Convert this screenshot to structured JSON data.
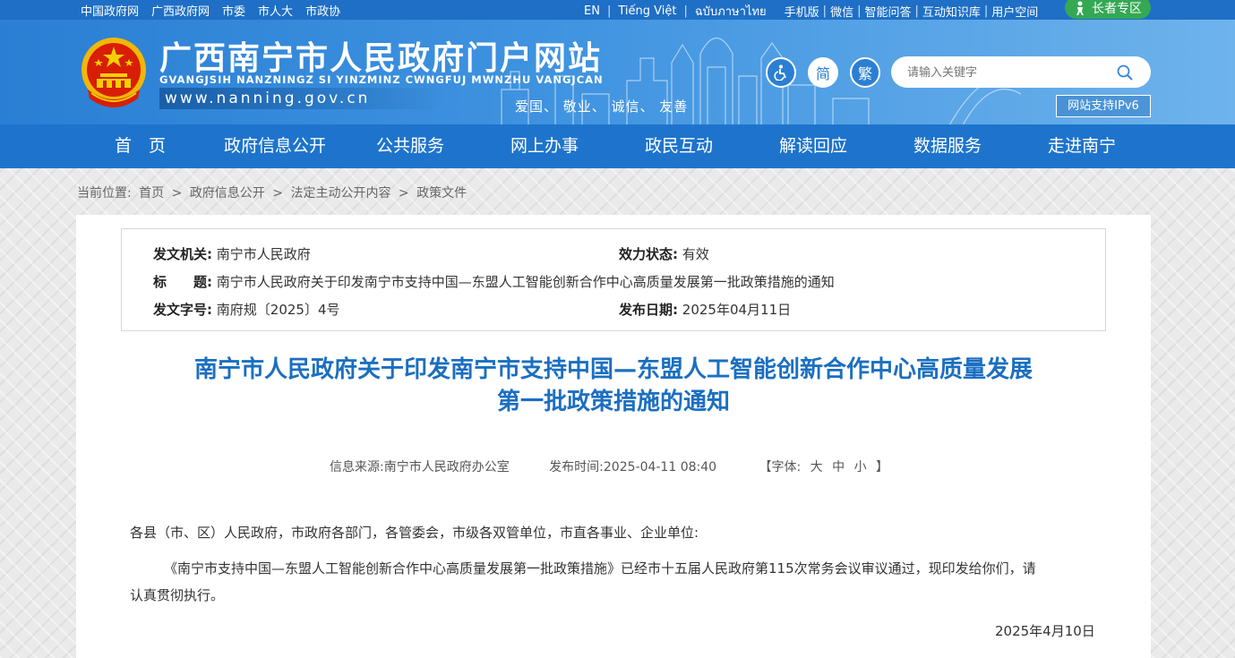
{
  "topbar": {
    "links": [
      "中国政府网",
      "广西政府网",
      "市委",
      "市人大",
      "市政协"
    ],
    "languages": [
      "EN",
      "Tiếng Việt",
      "ฉบับภาษาไทย"
    ],
    "tools": [
      "手机版",
      "微信",
      "智能问答",
      "互动知识库",
      "用户空间"
    ],
    "elder_label": "长者专区"
  },
  "header": {
    "site_title": "广西南宁市人民政府门户网站",
    "site_subtitle": "GVANGJSIH NANZNINGZ SI YINZMINZ CWNGFUJ MWNZHU VANGJCAN",
    "url": "www.nanning.gov.cn",
    "slogan": "爱国、 敬业、 诚信、 友善",
    "accessibility_icon": "wheelchair-icon",
    "simplified_label": "简",
    "traditional_label": "繁",
    "search_placeholder": "请输入关键字",
    "ipv6_label": "网站支持IPv6"
  },
  "nav": {
    "items": [
      "首　页",
      "政府信息公开",
      "公共服务",
      "网上办事",
      "政民互动",
      "解读回应",
      "数据服务",
      "走进南宁"
    ]
  },
  "breadcrumb": {
    "prefix": "当前位置:",
    "items": [
      "首页",
      "政府信息公开",
      "法定主动公开内容",
      "政策文件"
    ],
    "separator": ">"
  },
  "meta": {
    "issuer_label": "发文机关:",
    "issuer": "南宁市人民政府",
    "status_label": "效力状态:",
    "status": "有效",
    "title_label": "标　　题:",
    "title": "南宁市人民政府关于印发南宁市支持中国—东盟人工智能创新合作中心高质量发展第一批政策措施的通知",
    "doc_no_label": "发文字号:",
    "doc_no": "南府规〔2025〕4号",
    "date_label": "发布日期:",
    "date": "2025年04月11日"
  },
  "article": {
    "title_line1": "南宁市人民政府关于印发南宁市支持中国—东盟人工智能创新合作中心高质量发展",
    "title_line2": "第一批政策措施的通知",
    "source": "信息来源:南宁市人民政府办公室",
    "publish_time": "发布时间:2025-04-11 08:40",
    "font_prefix": "【字体:",
    "font_large": "大",
    "font_medium": "中",
    "font_small": "小",
    "font_suffix": "】",
    "salutation": "各县（市、区）人民政府，市政府各部门，各管委会，市级各双管单位，市直各事业、企业单位:",
    "para1_line1": "《南宁市支持中国—东盟人工智能创新合作中心高质量发展第一批政策措施》已经市十五届人民政府第115次常务会议审议通过，现印发给你们，请",
    "para1_line2": "认真贯彻执行。",
    "sign_date": "2025年4月10日"
  },
  "colors": {
    "topbar": "#1e6fc5",
    "nav": "#1e74cc",
    "title": "#1b6fc0",
    "elder": "#34a853"
  }
}
